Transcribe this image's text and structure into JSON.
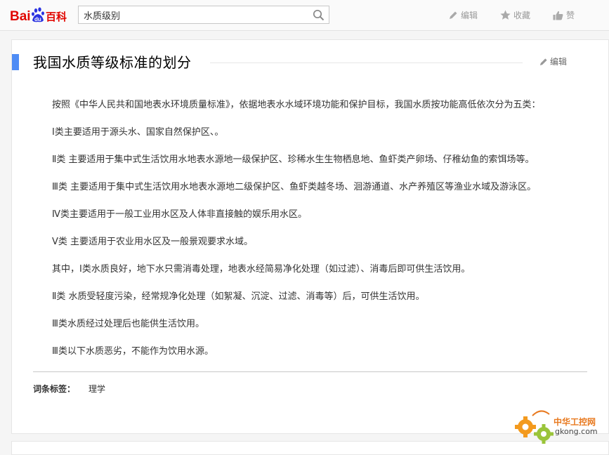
{
  "header": {
    "logo_text_1": "Bai",
    "logo_text_2": "du",
    "logo_text_3": "百科",
    "search_value": "水质级别",
    "edit_label": "编辑",
    "favorite_label": "收藏",
    "like_label": "赞"
  },
  "section": {
    "title": "我国水质等级标准的划分",
    "edit_label": "编辑",
    "paragraphs": [
      "按照《中华人民共和国地表水环境质量标准》，依据地表水水域环境功能和保护目标，我国水质按功能高低依次分为五类：",
      "Ⅰ类主要适用于源头水、国家自然保护区、。",
      "Ⅱ类 主要适用于集中式生活饮用水地表水源地一级保护区、珍稀水生生物栖息地、鱼虾类产卵场、仔稚幼鱼的索饵场等。",
      "Ⅲ类 主要适用于集中式生活饮用水地表水源地二级保护区、鱼虾类越冬场、洄游通道、水产养殖区等渔业水域及游泳区。",
      "Ⅳ类主要适用于一般工业用水区及人体非直接触的娱乐用水区。",
      "Ⅴ类 主要适用于农业用水区及一般景观要求水域。",
      "其中，Ⅰ类水质良好，地下水只需消毒处理，地表水经简易净化处理（如过滤）、消毒后即可供生活饮用。",
      "Ⅱ类 水质受轻度污染，经常规净化处理（如絮凝、沉淀、过滤、消毒等）后，可供生活饮用。",
      "Ⅲ类水质经过处理后也能供生活饮用。",
      "Ⅲ类以下水质恶劣，不能作为饮用水源。"
    ],
    "tag_label": "词条标签：",
    "tag_value": "理学"
  },
  "watermark": {
    "line1": "中华工控网",
    "line2": "gkong.com"
  },
  "colors": {
    "accent_blue": "#4e8cf5",
    "logo_red": "#e10601",
    "logo_blue": "#2932e1"
  }
}
